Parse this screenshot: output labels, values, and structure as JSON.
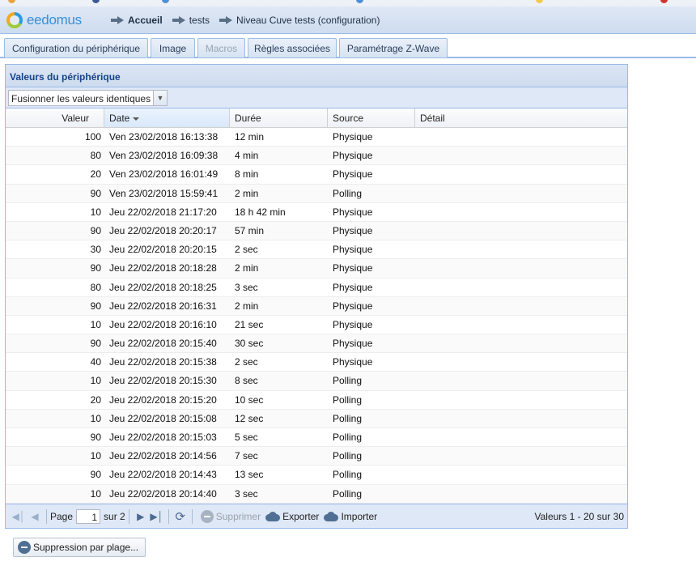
{
  "app": {
    "name": "eedomus"
  },
  "breadcrumb": [
    {
      "label": "Accueil"
    },
    {
      "label": "tests"
    },
    {
      "label": "Niveau Cuve tests (configuration)"
    }
  ],
  "tabs": [
    {
      "label": "Configuration du périphérique",
      "disabled": false
    },
    {
      "label": "Image",
      "disabled": false
    },
    {
      "label": "Macros",
      "disabled": true
    },
    {
      "label": "Règles associées",
      "disabled": false
    },
    {
      "label": "Paramétrage Z-Wave",
      "disabled": false
    }
  ],
  "panel": {
    "title": "Valeurs du périphérique",
    "filter_value": "Fusionner les valeurs identiques"
  },
  "grid": {
    "columns": [
      "Valeur",
      "Date",
      "Durée",
      "Source",
      "Détail"
    ],
    "sorted_column": "Date",
    "rows": [
      [
        "100",
        "Ven 23/02/2018 16:13:38",
        "12 min",
        "Physique",
        ""
      ],
      [
        "80",
        "Ven 23/02/2018 16:09:38",
        "4 min",
        "Physique",
        ""
      ],
      [
        "20",
        "Ven 23/02/2018 16:01:49",
        "8 min",
        "Physique",
        ""
      ],
      [
        "90",
        "Ven 23/02/2018 15:59:41",
        "2 min",
        "Polling",
        ""
      ],
      [
        "10",
        "Jeu 22/02/2018 21:17:20",
        "18 h 42 min",
        "Physique",
        ""
      ],
      [
        "90",
        "Jeu 22/02/2018 20:20:17",
        "57 min",
        "Physique",
        ""
      ],
      [
        "30",
        "Jeu 22/02/2018 20:20:15",
        "2 sec",
        "Physique",
        ""
      ],
      [
        "90",
        "Jeu 22/02/2018 20:18:28",
        "2 min",
        "Physique",
        ""
      ],
      [
        "80",
        "Jeu 22/02/2018 20:18:25",
        "3 sec",
        "Physique",
        ""
      ],
      [
        "90",
        "Jeu 22/02/2018 20:16:31",
        "2 min",
        "Physique",
        ""
      ],
      [
        "10",
        "Jeu 22/02/2018 20:16:10",
        "21 sec",
        "Physique",
        ""
      ],
      [
        "90",
        "Jeu 22/02/2018 20:15:40",
        "30 sec",
        "Physique",
        ""
      ],
      [
        "40",
        "Jeu 22/02/2018 20:15:38",
        "2 sec",
        "Physique",
        ""
      ],
      [
        "10",
        "Jeu 22/02/2018 20:15:30",
        "8 sec",
        "Polling",
        ""
      ],
      [
        "20",
        "Jeu 22/02/2018 20:15:20",
        "10 sec",
        "Polling",
        ""
      ],
      [
        "10",
        "Jeu 22/02/2018 20:15:08",
        "12 sec",
        "Polling",
        ""
      ],
      [
        "90",
        "Jeu 22/02/2018 20:15:03",
        "5 sec",
        "Polling",
        ""
      ],
      [
        "10",
        "Jeu 22/02/2018 20:14:56",
        "7 sec",
        "Polling",
        ""
      ],
      [
        "90",
        "Jeu 22/02/2018 20:14:43",
        "13 sec",
        "Polling",
        ""
      ],
      [
        "10",
        "Jeu 22/02/2018 20:14:40",
        "3 sec",
        "Polling",
        ""
      ]
    ]
  },
  "pager": {
    "page_label": "Page",
    "page_value": "1",
    "of_label": "sur 2",
    "delete_label": "Supprimer",
    "export_label": "Exporter",
    "import_label": "Importer",
    "status": "Valeurs 1 - 20 sur 30"
  },
  "bottom": {
    "range_delete_label": "Suppression par plage..."
  },
  "colors": {
    "accent": "#15428b",
    "border": "#99bbe8",
    "header_bg": "#dfe8f6"
  }
}
